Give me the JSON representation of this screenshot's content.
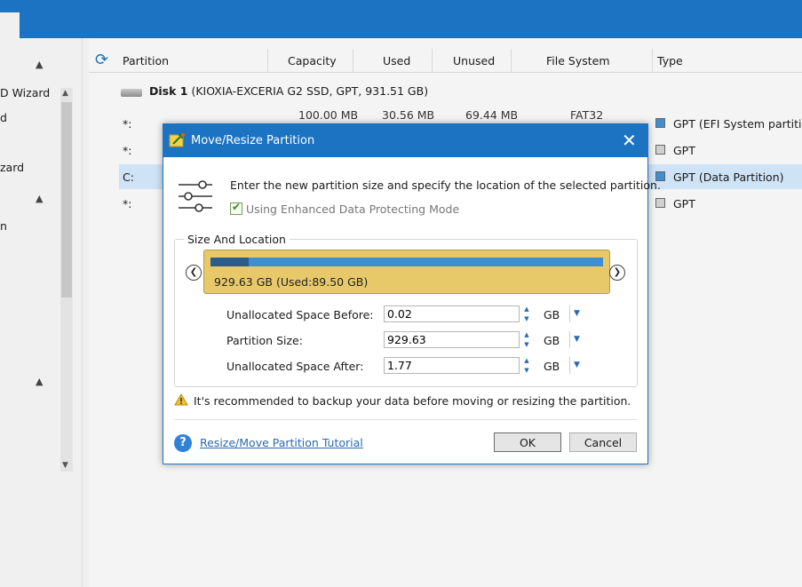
{
  "left_nav": {
    "items": [
      "D Wizard",
      "d",
      "zard",
      "n"
    ]
  },
  "table": {
    "columns": [
      "Partition",
      "Capacity",
      "Used",
      "Unused",
      "File System",
      "Type"
    ],
    "disk": {
      "name": "Disk 1",
      "details": "(KIOXIA-EXCERIA G2 SSD, GPT, 931.51 GB)"
    },
    "rows": [
      {
        "partition": "*:",
        "capacity": "100.00 MB",
        "used": "30.56 MB",
        "unused": "69.44 MB",
        "fs": "FAT32",
        "type": "GPT (EFI System partition)",
        "type_color": "#3e8fd2"
      },
      {
        "partition": "*:",
        "type": "GPT",
        "type_color": "#d0d0d0"
      },
      {
        "partition": "C:",
        "type": "GPT (Data Partition)",
        "type_color": "#3e8fd2"
      },
      {
        "partition": "*:",
        "type": "GPT",
        "type_color": "#d0d0d0"
      }
    ]
  },
  "dialog": {
    "title": "Move/Resize Partition",
    "intro": "Enter the new partition size and specify the location of the selected partition.",
    "enhanced_mode": {
      "label": "Using Enhanced Data Protecting Mode",
      "checked": true
    },
    "group_label": "Size And Location",
    "bar": {
      "label": "929.63 GB (Used:89.50 GB)",
      "used_fraction": 0.0963
    },
    "fields": [
      {
        "label": "Unallocated Space Before:",
        "value": "0.02",
        "unit": "GB"
      },
      {
        "label": "Partition Size:",
        "value": "929.63",
        "unit": "GB"
      },
      {
        "label": "Unallocated Space After:",
        "value": "1.77",
        "unit": "GB"
      }
    ],
    "warning": "It's recommended to backup your data before moving or resizing the partition.",
    "help_link": "Resize/Move Partition Tutorial",
    "ok_label": "OK",
    "cancel_label": "Cancel"
  },
  "colors": {
    "accent": "#1b73c2",
    "bar_fill": "#e8c96a",
    "selected_row": "#cfe3f6"
  }
}
